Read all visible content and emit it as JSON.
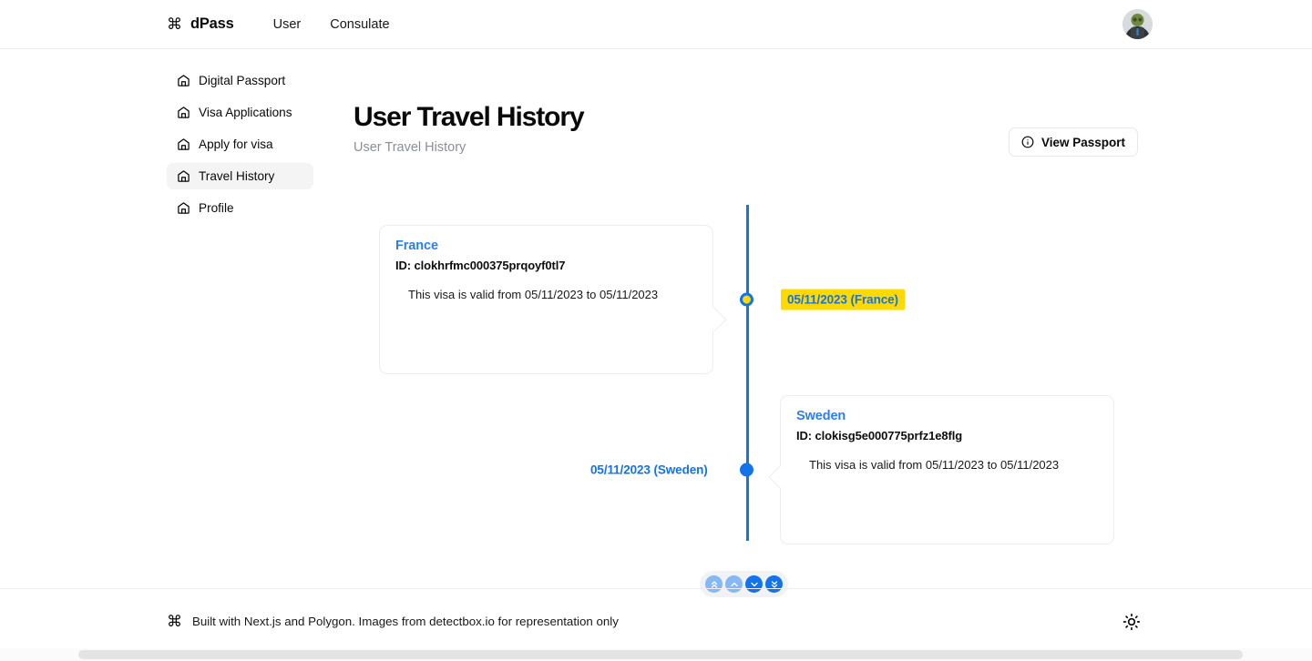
{
  "header": {
    "brand_icon": "command-icon",
    "brand_name": "dPass",
    "nav": [
      {
        "label": "User"
      },
      {
        "label": "Consulate"
      }
    ],
    "avatar_alt": "user-avatar"
  },
  "sidebar": {
    "items": [
      {
        "label": "Digital Passport",
        "icon": "home-icon",
        "active": false
      },
      {
        "label": "Visa Applications",
        "icon": "home-icon",
        "active": false
      },
      {
        "label": "Apply for visa",
        "icon": "home-icon",
        "active": false
      },
      {
        "label": "Travel History",
        "icon": "home-icon",
        "active": true
      },
      {
        "label": "Profile",
        "icon": "home-icon",
        "active": false
      }
    ]
  },
  "main": {
    "title": "User Travel History",
    "subtitle": "User Travel History",
    "view_passport": {
      "label": "View Passport",
      "icon": "info-circle-icon"
    }
  },
  "timeline": {
    "line_color": "#1273ea",
    "highlight_color": "#ffd900",
    "events": [
      {
        "country": "France",
        "id_label": "ID: clokhrfmc000375prqoyf0tl7",
        "description": "This visa is valid from 05/11/2023 to 05/11/2023",
        "date_label": "05/11/2023 (France)",
        "side": "left",
        "marker": "hollow",
        "highlighted": true
      },
      {
        "country": "Sweden",
        "id_label": "ID: clokisg5e000775prfz1e8flg",
        "description": "This visa is valid from 05/11/2023 to 05/11/2023",
        "date_label": "05/11/2023 (Sweden)",
        "side": "right",
        "marker": "solid",
        "highlighted": false
      }
    ],
    "controls": [
      {
        "icon": "chevrons-up-icon",
        "state": "dim"
      },
      {
        "icon": "chevron-up-icon",
        "state": "dim"
      },
      {
        "icon": "chevron-down-icon",
        "state": "bright"
      },
      {
        "icon": "chevrons-down-icon",
        "state": "bright"
      }
    ]
  },
  "footer": {
    "icon": "command-icon",
    "text": "Built with Next.js and Polygon. Images from detectbox.io for representation only",
    "theme_icon": "sun-icon"
  }
}
